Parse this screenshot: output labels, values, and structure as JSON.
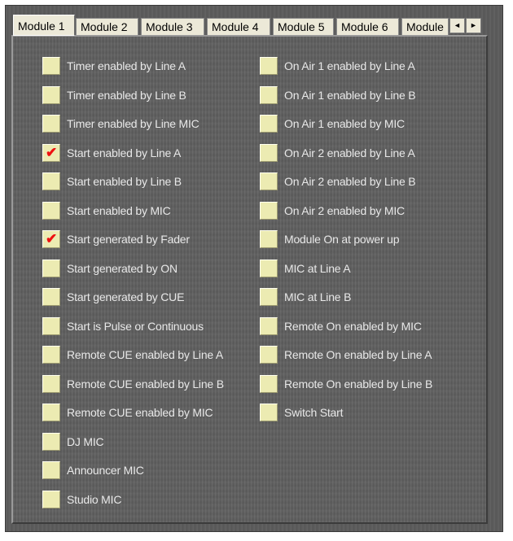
{
  "tabs": [
    {
      "label": "Module 1",
      "active": true
    },
    {
      "label": "Module 2",
      "active": false
    },
    {
      "label": "Module 3",
      "active": false
    },
    {
      "label": "Module 4",
      "active": false
    },
    {
      "label": "Module 5",
      "active": false
    },
    {
      "label": "Module 6",
      "active": false
    },
    {
      "label": "Module",
      "active": false
    }
  ],
  "scroll": {
    "left_glyph": "◄",
    "right_glyph": "►"
  },
  "check_glyph": "✔",
  "left_column": [
    {
      "label": "Timer enabled by Line A",
      "checked": false
    },
    {
      "label": "Timer enabled by Line B",
      "checked": false
    },
    {
      "label": "Timer enabled by Line MIC",
      "checked": false
    },
    {
      "label": "Start  enabled by Line A",
      "checked": true
    },
    {
      "label": "Start  enabled by Line B",
      "checked": false
    },
    {
      "label": "Start  enabled by MIC",
      "checked": false
    },
    {
      "label": "Start generated by Fader",
      "checked": true
    },
    {
      "label": "Start generated by ON",
      "checked": false
    },
    {
      "label": "Start generated by CUE",
      "checked": false
    },
    {
      "label": "Start is Pulse or Continuous",
      "checked": false
    },
    {
      "label": "Remote CUE enabled by Line A",
      "checked": false
    },
    {
      "label": "Remote CUE enabled by Line B",
      "checked": false
    },
    {
      "label": "Remote CUE enabled by MIC",
      "checked": false
    },
    {
      "label": "DJ MIC",
      "checked": false
    },
    {
      "label": "Announcer MIC",
      "checked": false
    },
    {
      "label": "Studio MIC",
      "checked": false
    }
  ],
  "right_column": [
    {
      "label": "On Air 1 enabled by Line A",
      "checked": false
    },
    {
      "label": "On Air 1 enabled by Line B",
      "checked": false
    },
    {
      "label": "On Air 1 enabled by  MIC",
      "checked": false
    },
    {
      "label": "On Air 2 enabled by Line A",
      "checked": false
    },
    {
      "label": "On Air 2 enabled by Line B",
      "checked": false
    },
    {
      "label": "On Air 2 enabled by MIC",
      "checked": false
    },
    {
      "label": "Module On at power up",
      "checked": false
    },
    {
      "label": "MIC at Line A",
      "checked": false
    },
    {
      "label": "MIC at Line B",
      "checked": false
    },
    {
      "label": "Remote On enabled by MIC",
      "checked": false
    },
    {
      "label": "Remote On enabled by Line A",
      "checked": false
    },
    {
      "label": "Remote On enabled by Line B",
      "checked": false
    },
    {
      "label": "Switch Start",
      "checked": false
    }
  ]
}
